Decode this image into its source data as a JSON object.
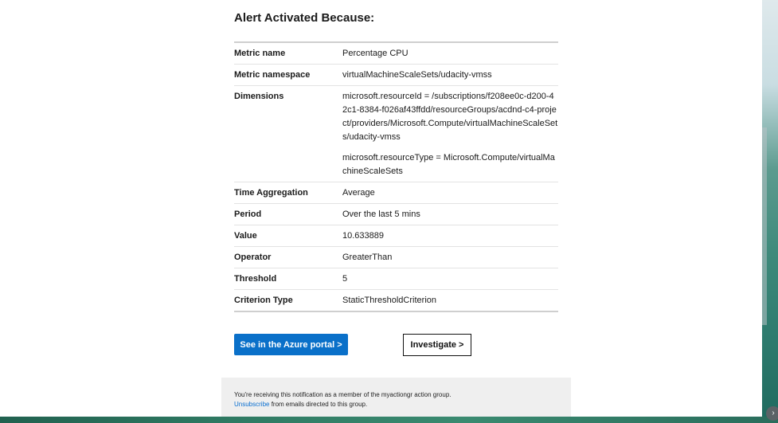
{
  "section": {
    "title": "Alert Activated Because:"
  },
  "rows": [
    {
      "label": "Metric name",
      "values": [
        "Percentage CPU"
      ]
    },
    {
      "label": "Metric namespace",
      "values": [
        "virtualMachineScaleSets/udacity-vmss"
      ]
    },
    {
      "label": "Dimensions",
      "values": [
        "microsoft.resourceId = /subscriptions/f208ee0c-d200-42c1-8384-f026af43ffdd/resourceGroups/acdnd-c4-project/providers/Microsoft.Compute/virtualMachineScaleSets/udacity-vmss",
        "microsoft.resourceType = Microsoft.Compute/virtualMachineScaleSets"
      ]
    },
    {
      "label": "Time Aggregation",
      "values": [
        "Average"
      ]
    },
    {
      "label": "Period",
      "values": [
        "Over the last 5 mins"
      ]
    },
    {
      "label": "Value",
      "values": [
        "10.633889"
      ]
    },
    {
      "label": "Operator",
      "values": [
        "GreaterThan"
      ]
    },
    {
      "label": "Threshold",
      "values": [
        "5"
      ]
    },
    {
      "label": "Criterion Type",
      "values": [
        "StaticThresholdCriterion"
      ]
    }
  ],
  "buttons": {
    "portal_label": "See in the Azure portal >",
    "investigate_label": "Investigate >"
  },
  "footer": {
    "notice": "You're receiving this notification as a member of the myactiongr action group.",
    "unsubscribe_link": "Unsubscribe",
    "unsubscribe_suffix": " from emails directed to this group."
  },
  "colors": {
    "primary": "#0a70c9",
    "link": "#0a6fd0",
    "footer_bg": "#efefef"
  }
}
